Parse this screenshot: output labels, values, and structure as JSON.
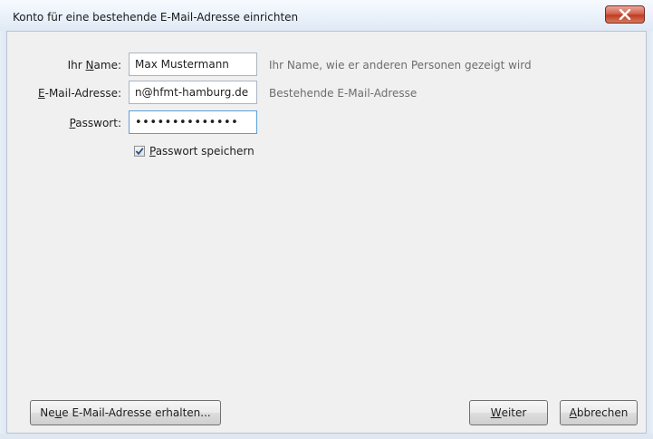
{
  "window": {
    "title": "Konto für eine bestehende E-Mail-Adresse einrichten",
    "close_icon": "close-x-icon"
  },
  "form": {
    "name": {
      "label_prefix": "Ihr ",
      "label_access": "N",
      "label_rest": "ame:",
      "value": "Max Mustermann",
      "hint": "Ihr Name, wie er anderen Personen gezeigt wird"
    },
    "email": {
      "label_access": "E",
      "label_rest": "-Mail-Adresse:",
      "value": "n@hfmt-hamburg.de",
      "hint": "Bestehende E-Mail-Adresse"
    },
    "password": {
      "label_access": "P",
      "label_rest": "asswort:",
      "value": "••••••••••••••"
    },
    "remember": {
      "checked": true,
      "label_access": "P",
      "label_rest": "asswort speichern"
    }
  },
  "buttons": {
    "new_address": {
      "pre": "Ne",
      "access": "u",
      "post": "e E-Mail-Adresse erhalten..."
    },
    "next": {
      "access": "W",
      "post": "eiter"
    },
    "cancel": {
      "access": "A",
      "post": "bbrechen"
    }
  }
}
